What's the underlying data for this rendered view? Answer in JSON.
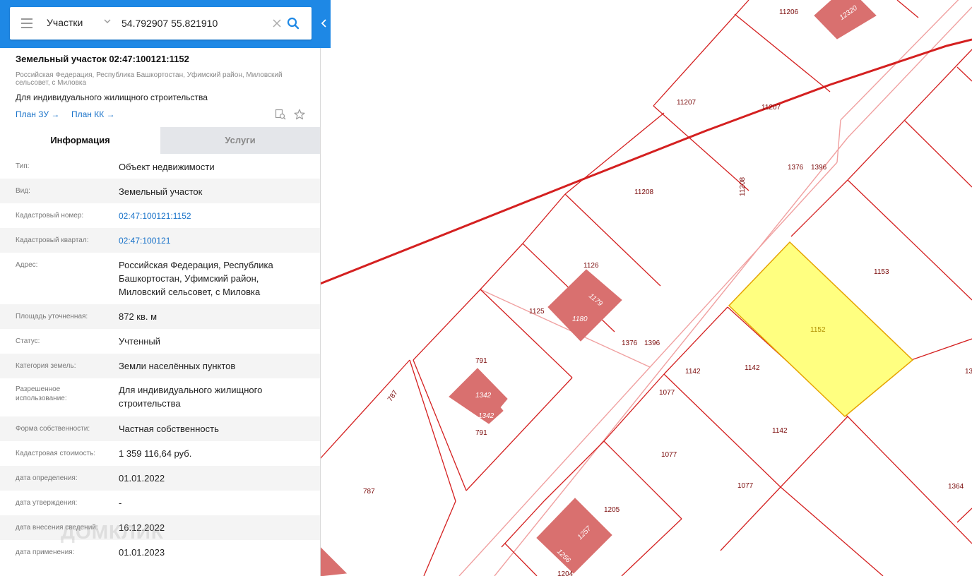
{
  "search": {
    "layer_label": "Участки",
    "query": "54.792907 55.821910"
  },
  "parcel": {
    "title": "Земельный участок 02:47:100121:1152",
    "address": "Российская Федерация, Республика Башкортостан, Уфимский район, Миловский сельсовет, с Миловка",
    "purpose": "Для индивидуального жилищного строительства",
    "plan_zu_link": "План ЗУ →",
    "plan_kk_link": "План КК →"
  },
  "tabs": {
    "info": "Информация",
    "services": "Услуги"
  },
  "info_rows": [
    {
      "key": "Тип:",
      "value": "Объект недвижимости"
    },
    {
      "key": "Вид:",
      "value": "Земельный участок"
    },
    {
      "key": "Кадастровый номер:",
      "value": "02:47:100121:1152"
    },
    {
      "key": "Кадастровый квартал:",
      "value": "02:47:100121"
    },
    {
      "key": "Адрес:",
      "value": "Российская Федерация, Республика Башкортостан, Уфимский район, Миловский сельсовет, с Миловка"
    },
    {
      "key": "Площадь уточненная:",
      "value": "872 кв. м"
    },
    {
      "key": "Статус:",
      "value": "Учтенный"
    },
    {
      "key": "Категория земель:",
      "value": "Земли населённых пунктов"
    },
    {
      "key": "Разрешенное использование:",
      "value": "Для индивидуального жилищного строительства"
    },
    {
      "key": "Форма собственности:",
      "value": "Частная собственность"
    },
    {
      "key": "Кадастровая стоимость:",
      "value": "1 359 116,64 руб."
    },
    {
      "key": "дата определения:",
      "value": "01.01.2022"
    },
    {
      "key": "дата утверждения:",
      "value": "-"
    },
    {
      "key": "дата внесения сведений:",
      "value": "16.12.2022"
    },
    {
      "key": "дата применения:",
      "value": "01.01.2023"
    }
  ],
  "watermark": "ДОМКЛИК",
  "map": {
    "colors": {
      "boundary": "#d42020",
      "building_fill": "#d9706f",
      "selected_fill": "#ffff80",
      "road": "#f0a0a0"
    },
    "labels": [
      "11206",
      "12320",
      "11207",
      "11207",
      "11208",
      "11208",
      "1376",
      "1396",
      "1376",
      "1396",
      "1126",
      "1179",
      "1180",
      "1125",
      "1153",
      "1152",
      "1142",
      "1142",
      "1142",
      "1077",
      "1077",
      "1077",
      "791",
      "1342",
      "1342",
      "791",
      "787",
      "787",
      "1205",
      "1257",
      "1256",
      "1204",
      "1364",
      "13"
    ]
  }
}
